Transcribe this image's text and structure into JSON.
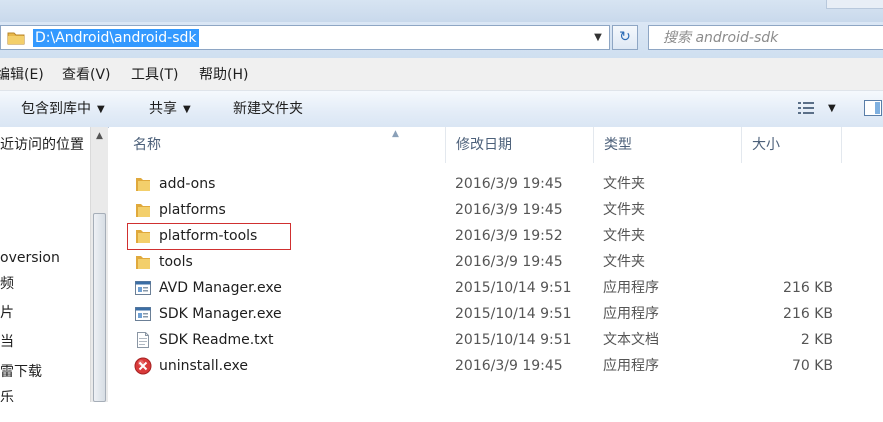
{
  "address_bar": {
    "path": "D:\\Android\\android-sdk",
    "search_placeholder": "搜索 android-sdk"
  },
  "menu": [
    {
      "label": "编辑(E)"
    },
    {
      "label": "查看(V)"
    },
    {
      "label": "工具(T)"
    },
    {
      "label": "帮助(H)"
    }
  ],
  "toolbar": {
    "include_library": "包含到库中",
    "share": "共享",
    "new_folder": "新建文件夹"
  },
  "nav": {
    "items": [
      {
        "label": "近访问的位置"
      },
      {
        "label": "oversion"
      },
      {
        "label": "频"
      },
      {
        "label": "片"
      },
      {
        "label": "当"
      },
      {
        "label": "雷下载"
      },
      {
        "label": "乐"
      }
    ]
  },
  "columns": {
    "name": "名称",
    "date": "修改日期",
    "type": "类型",
    "size": "大小"
  },
  "files": [
    {
      "name": "add-ons",
      "date": "2016/3/9 19:45",
      "type": "文件夹",
      "size": "",
      "icon": "folder-icon"
    },
    {
      "name": "platforms",
      "date": "2016/3/9 19:45",
      "type": "文件夹",
      "size": "",
      "icon": "folder-icon"
    },
    {
      "name": "platform-tools",
      "date": "2016/3/9 19:52",
      "type": "文件夹",
      "size": "",
      "icon": "folder-icon"
    },
    {
      "name": "tools",
      "date": "2016/3/9 19:45",
      "type": "文件夹",
      "size": "",
      "icon": "folder-icon"
    },
    {
      "name": "AVD Manager.exe",
      "date": "2015/10/14 9:51",
      "type": "应用程序",
      "size": "216 KB",
      "icon": "exe-icon"
    },
    {
      "name": "SDK Manager.exe",
      "date": "2015/10/14 9:51",
      "type": "应用程序",
      "size": "216 KB",
      "icon": "exe-icon"
    },
    {
      "name": "SDK Readme.txt",
      "date": "2015/10/14 9:51",
      "type": "文本文档",
      "size": "2 KB",
      "icon": "text-file-icon"
    },
    {
      "name": "uninstall.exe",
      "date": "2016/3/9 19:45",
      "type": "应用程序",
      "size": "70 KB",
      "icon": "uninstall-icon"
    }
  ],
  "colors": {
    "selection": "#3399ff",
    "highlight_border": "#d03030",
    "folder": "#e8b84a"
  }
}
